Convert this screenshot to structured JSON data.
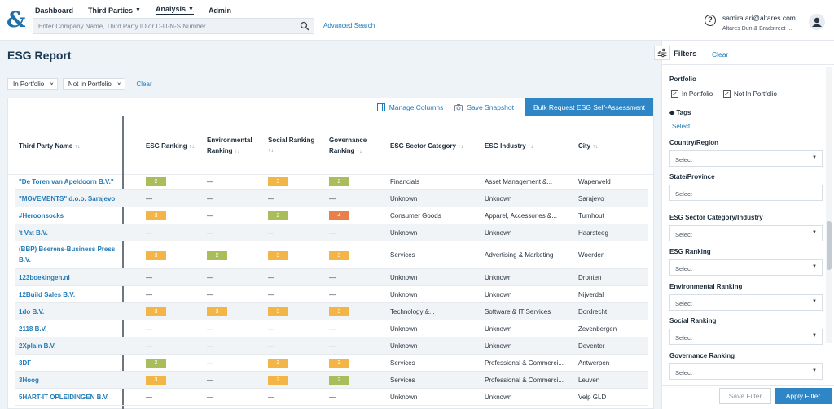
{
  "nav": {
    "items": [
      {
        "label": "Dashboard",
        "dropdown": false,
        "active": false
      },
      {
        "label": "Third Parties",
        "dropdown": true,
        "active": false
      },
      {
        "label": "Analysis",
        "dropdown": true,
        "active": true
      },
      {
        "label": "Admin",
        "dropdown": false,
        "active": false
      }
    ],
    "search_placeholder": "Enter Company Name, Third Party ID or D-U-N-S Number",
    "advanced_search": "Advanced Search",
    "help_glyph": "?",
    "user_email": "samira.ari@altares.com",
    "user_org": "Altares Dun & Bradstreet ..."
  },
  "page": {
    "title": "ESG Report",
    "chips": [
      "In Portfolio",
      "Not In Portfolio"
    ],
    "chip_close": "×",
    "clear_label": "Clear"
  },
  "toolbar": {
    "manage_columns": "Manage Columns",
    "save_snapshot": "Save Snapshot",
    "bulk_request": "Bulk Request ESG Self-Assessment"
  },
  "table": {
    "sort_glyph": "↑↓",
    "headers": {
      "name": "Third Party Name",
      "esg": "ESG Ranking",
      "env1": "Environmental",
      "env2": "Ranking",
      "social": "Social Ranking",
      "gov1": "Governance",
      "gov2": "Ranking",
      "sector": "ESG Sector Category",
      "industry": "ESG Industry",
      "city": "City"
    },
    "dash": "—",
    "rows": [
      {
        "name": "\"De Toren van Apeldoorn B.V.\"",
        "esg": "2",
        "env": "",
        "social": "3",
        "gov": "2",
        "sector": "Financials",
        "industry": "Asset Management &...",
        "city": "Wapenveld"
      },
      {
        "name": "\"MOVEMENTS\" d.o.o. Sarajevo",
        "esg": "",
        "env": "",
        "social": "",
        "gov": "",
        "sector": "Unknown",
        "industry": "Unknown",
        "city": "Sarajevo"
      },
      {
        "name": "#Heroonsocks",
        "esg": "3",
        "env": "",
        "social": "2",
        "gov": "4",
        "sector": "Consumer Goods",
        "industry": "Apparel, Accessories &...",
        "city": "Turnhout"
      },
      {
        "name": "'t Vat B.V.",
        "esg": "",
        "env": "",
        "social": "",
        "gov": "",
        "sector": "Unknown",
        "industry": "Unknown",
        "city": "Haarsteeg"
      },
      {
        "name": "(BBP) Beerens-Business Press B.V.",
        "esg": "3",
        "env": "2",
        "social": "3",
        "gov": "3",
        "sector": "Services",
        "industry": "Advertising & Marketing",
        "city": "Woerden"
      },
      {
        "name": "123boekingen.nl",
        "esg": "",
        "env": "",
        "social": "",
        "gov": "",
        "sector": "Unknown",
        "industry": "Unknown",
        "city": "Dronten"
      },
      {
        "name": "12Build Sales B.V.",
        "esg": "",
        "env": "",
        "social": "",
        "gov": "",
        "sector": "Unknown",
        "industry": "Unknown",
        "city": "Nijverdal"
      },
      {
        "name": "1do B.V.",
        "esg": "3",
        "env": "3",
        "social": "3",
        "gov": "3",
        "sector": "Technology &...",
        "industry": "Software & IT Services",
        "city": "Dordrecht"
      },
      {
        "name": "2118 B.V.",
        "esg": "",
        "env": "",
        "social": "",
        "gov": "",
        "sector": "Unknown",
        "industry": "Unknown",
        "city": "Zevenbergen"
      },
      {
        "name": "2Xplain B.V.",
        "esg": "",
        "env": "",
        "social": "",
        "gov": "",
        "sector": "Unknown",
        "industry": "Unknown",
        "city": "Deventer"
      },
      {
        "name": "3DF",
        "esg": "2",
        "env": "",
        "social": "3",
        "gov": "3",
        "sector": "Services",
        "industry": "Professional & Commerci...",
        "city": "Antwerpen"
      },
      {
        "name": "3Hoog",
        "esg": "3",
        "env": "",
        "social": "3",
        "gov": "2",
        "sector": "Services",
        "industry": "Professional & Commerci...",
        "city": "Leuven"
      },
      {
        "name": "5HART-IT OPLEIDINGEN B.V.",
        "esg": "",
        "env": "",
        "social": "",
        "gov": "",
        "sector": "Unknown",
        "industry": "Unknown",
        "city": "Velp GLD"
      }
    ]
  },
  "filters": {
    "title": "Filters",
    "clear": "Clear",
    "portfolio_label": "Portfolio",
    "in_portfolio": "In Portfolio",
    "not_in_portfolio": "Not In Portfolio",
    "check_glyph": "✓",
    "tags_label": "Tags",
    "tags_select": "Select",
    "sections": [
      {
        "label": "Country/Region",
        "value": "Select",
        "arrow": true
      },
      {
        "label": "State/Province",
        "value": "Select",
        "arrow": false
      },
      {
        "label": "ESG Sector Category/Industry",
        "value": "Select",
        "arrow": true
      },
      {
        "label": "ESG Ranking",
        "value": "Select",
        "arrow": true
      },
      {
        "label": "Environmental Ranking",
        "value": "Select",
        "arrow": true
      },
      {
        "label": "Social Ranking",
        "value": "Select",
        "arrow": true
      },
      {
        "label": "Governance Ranking",
        "value": "Select",
        "arrow": true
      }
    ],
    "save_filter": "Save Filter",
    "apply_filter": "Apply Filter"
  },
  "colors": {
    "accent": "#2e86c7",
    "rank2": "#a9bd5b",
    "rank3": "#f2b546",
    "rank4": "#e9804b"
  }
}
